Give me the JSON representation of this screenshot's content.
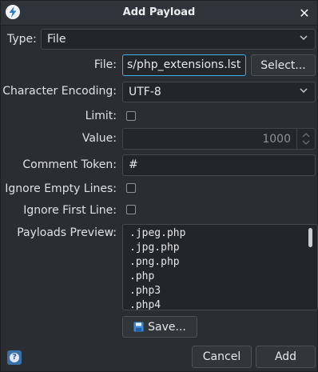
{
  "window": {
    "title": "Add Payload"
  },
  "form": {
    "type_label": "Type:",
    "type_value": "File",
    "file_label": "File:",
    "file_value": "s/php_extensions.lst",
    "select_button": "Select...",
    "encoding_label": "Character Encoding:",
    "encoding_value": "UTF-8",
    "limit_label": "Limit:",
    "limit_checked": false,
    "value_label": "Value:",
    "value_value": "1000",
    "comment_label": "Comment Token:",
    "comment_value": "#",
    "ignore_empty_label": "Ignore Empty Lines:",
    "ignore_empty_checked": false,
    "ignore_first_label": "Ignore First Line:",
    "ignore_first_checked": false,
    "preview_label": "Payloads Preview:",
    "preview_items": [
      ".jpeg.php",
      ".jpg.php",
      ".png.php",
      ".php",
      ".php3",
      ".php4"
    ],
    "save_button": "Save..."
  },
  "footer": {
    "cancel_button": "Cancel",
    "add_button": "Add"
  },
  "icons": {
    "app": "zap-icon",
    "close": "close-icon",
    "chevron": "chevron-down-icon",
    "save": "floppy-disk-icon",
    "help": "help-icon"
  },
  "colors": {
    "focus_border": "#3daee9",
    "background": "#2a2e32"
  }
}
